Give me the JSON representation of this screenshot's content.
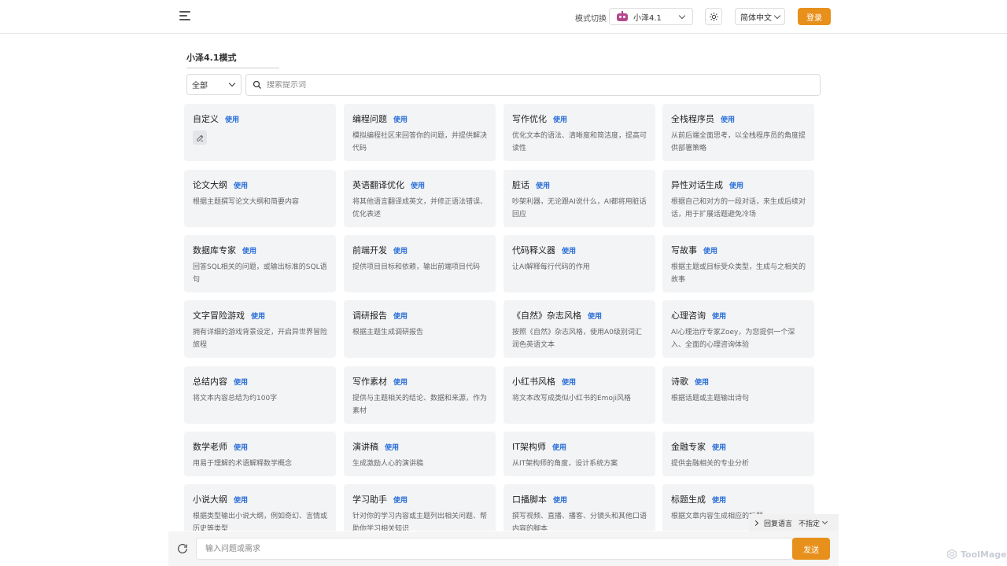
{
  "header": {
    "mode_label": "模式切换",
    "model_name": "小泽4.1",
    "language": "简体中文",
    "login_label": "登录"
  },
  "page": {
    "title": "小泽4.1模式"
  },
  "filter": {
    "selected": "全部"
  },
  "search": {
    "placeholder": "搜索提示词"
  },
  "use_label": "使用",
  "cards": [
    {
      "title": "自定义",
      "desc": ""
    },
    {
      "title": "编程问题",
      "desc": "模拟编程社区来回答你的问题，并提供解决代码"
    },
    {
      "title": "写作优化",
      "desc": "优化文本的语法、清晰度和简洁度，提高可读性"
    },
    {
      "title": "全栈程序员",
      "desc": "从前后端全面思考，以全栈程序员的角度提供部署策略"
    },
    {
      "title": "论文大纲",
      "desc": "根据主题撰写论文大纲和简要内容"
    },
    {
      "title": "英语翻译优化",
      "desc": "将其他语言翻译成英文，并修正语法错误、优化表述"
    },
    {
      "title": "脏话",
      "desc": "吵架利器，无论跟AI说什么，AI都将用脏话回应"
    },
    {
      "title": "异性对话生成",
      "desc": "根据自己和对方的一段对话，来生成后续对话，用于扩展话题避免冷场"
    },
    {
      "title": "数据库专家",
      "desc": "回答SQL相关的问题，或输出标准的SQL语句"
    },
    {
      "title": "前端开发",
      "desc": "提供项目目标和依赖，输出前端项目代码"
    },
    {
      "title": "代码释义器",
      "desc": "让AI解释每行代码的作用"
    },
    {
      "title": "写故事",
      "desc": "根据主题或目标受众类型，生成与之相关的故事"
    },
    {
      "title": "文字冒险游戏",
      "desc": "拥有详细的游戏背景设定，开启异世界冒险旅程"
    },
    {
      "title": "调研报告",
      "desc": "根据主题生成调研报告"
    },
    {
      "title": "《自然》杂志风格",
      "desc": "按照《自然》杂志风格，使用A0级别词汇润色英语文本"
    },
    {
      "title": "心理咨询",
      "desc": "AI心理治疗专家Zoey，为您提供一个深入、全面的心理咨询体验"
    },
    {
      "title": "总结内容",
      "desc": "将文本内容总结为约100字"
    },
    {
      "title": "写作素材",
      "desc": "提供与主题相关的结论、数据和来源，作为素材"
    },
    {
      "title": "小红书风格",
      "desc": "将文本改写成类似小红书的Emoji风格"
    },
    {
      "title": "诗歌",
      "desc": "根据话题或主题输出诗句"
    },
    {
      "title": "数学老师",
      "desc": "用易于理解的术语解释数学概念"
    },
    {
      "title": "演讲稿",
      "desc": "生成激励人心的演讲稿"
    },
    {
      "title": "IT架构师",
      "desc": "从IT架构师的角度，设计系统方案"
    },
    {
      "title": "金融专家",
      "desc": "提供金融相关的专业分析"
    },
    {
      "title": "小说大纲",
      "desc": "根据类型输出小说大纲，例如奇幻、言情或历史等类型"
    },
    {
      "title": "学习助手",
      "desc": "针对你的学习内容或主题列出相关问题、帮助你学习相关知识"
    },
    {
      "title": "口播脚本",
      "desc": "撰写视频、直播、播客、分镜头和其他口语内容的脚本"
    },
    {
      "title": "标题生成",
      "desc": "根据文章内容生成相应的标题"
    }
  ],
  "reply_language": {
    "label": "回复语言",
    "value": "不指定"
  },
  "chat": {
    "placeholder": "输入问题或需求",
    "send_label": "发送"
  },
  "watermark": "ToolMage",
  "colors": {
    "accent": "#e8901c",
    "link": "#2b6fd8",
    "card_bg": "#f3f4f6"
  }
}
